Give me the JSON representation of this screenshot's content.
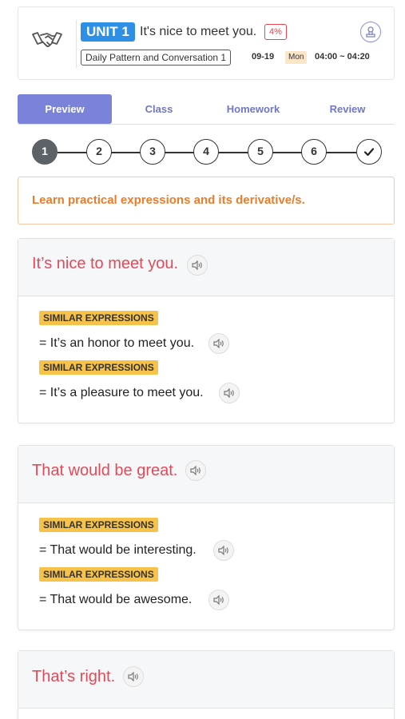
{
  "header": {
    "unit_label": "UNIT 1",
    "lesson_title": "It's nice to meet you.",
    "progress_percent_label": "4%",
    "course_name": "Daily Pattern and Conversation 1",
    "date": "09-19",
    "day": "Mon",
    "time": "04:00 ~ 04:20",
    "icons": [
      "handshake-icon",
      "tts-icon"
    ]
  },
  "tabs": [
    {
      "label": "Preview",
      "active": true
    },
    {
      "label": "Class",
      "active": false
    },
    {
      "label": "Homework",
      "active": false
    },
    {
      "label": "Review",
      "active": false
    }
  ],
  "stepper": {
    "steps": [
      "1",
      "2",
      "3",
      "4",
      "5",
      "6"
    ],
    "current": "1",
    "final_icon": "check-icon"
  },
  "objective": "Learn practical expressions and its derivative/s.",
  "similar_label": "SIMILAR EXPRESSIONS",
  "expressions": [
    {
      "title": "It’s nice to meet you.",
      "similar": [
        "= It’s an honor to meet you.",
        "= It’s a pleasure to meet you."
      ]
    },
    {
      "title": "That would be great.",
      "similar": [
        "= That would be interesting.",
        "= That would be awesome."
      ]
    },
    {
      "title": "That’s right.",
      "similar": []
    }
  ],
  "colors": {
    "accent": "#7a83d9",
    "unit_badge": "#2f8ee5",
    "title_red": "#e24a5a",
    "objective_orange": "#ea7c2b",
    "similar_tag": "#f7c24a"
  }
}
